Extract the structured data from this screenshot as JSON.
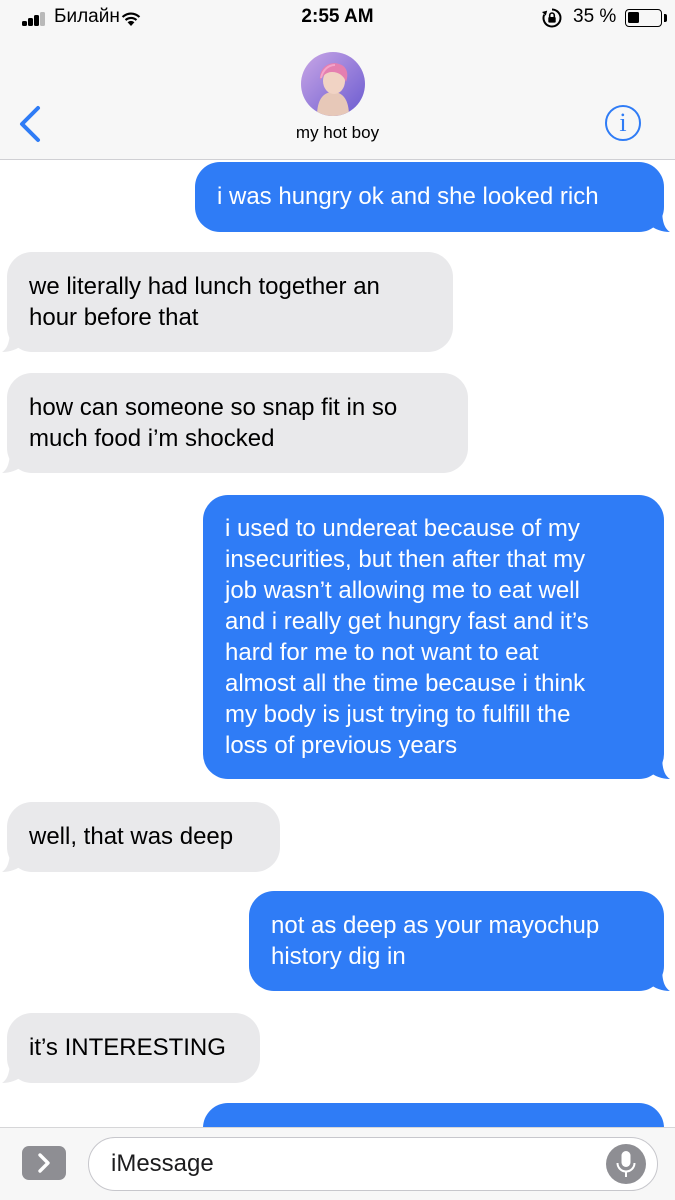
{
  "status_bar": {
    "carrier": "Билайн",
    "time": "2:55 AM",
    "battery_percent": "35 %",
    "battery_level": 0.35,
    "signal_bars": 3
  },
  "header": {
    "contact_name": "my hot boy",
    "back_icon": "chevron-left-icon",
    "info_icon": "info-icon",
    "info_glyph": "i"
  },
  "messages": [
    {
      "direction": "sent",
      "lines": [
        "i was hungry ok and she looked rich"
      ]
    },
    {
      "direction": "received",
      "lines": [
        "we literally had lunch together an",
        "hour before that"
      ]
    },
    {
      "direction": "received",
      "lines": [
        "how can someone so snap fit in so",
        "much food i’m shocked"
      ]
    },
    {
      "direction": "sent",
      "lines": [
        "i used to undereat because of my",
        "insecurities, but then after that my",
        "job wasn’t allowing me to eat well",
        "and i really get hungry fast and it’s",
        "hard for me to not want to eat",
        "almost all the time because i think",
        "my body is just trying to fulfill the",
        "loss of previous years"
      ]
    },
    {
      "direction": "received",
      "lines": [
        "well, that was deep"
      ]
    },
    {
      "direction": "sent",
      "lines": [
        "not as deep as your mayochup",
        "history dig in"
      ]
    },
    {
      "direction": "received",
      "lines": [
        "it’s INTERESTING"
      ]
    },
    {
      "direction": "sent",
      "lines": []
    }
  ],
  "input_bar": {
    "placeholder": "iMessage",
    "apps_icon": "chevron-right-icon",
    "mic_icon": "microphone-icon"
  },
  "colors": {
    "sent_bubble": "#2f7cf6",
    "received_bubble": "#e9e9eb",
    "accent": "#2f7cf6"
  }
}
